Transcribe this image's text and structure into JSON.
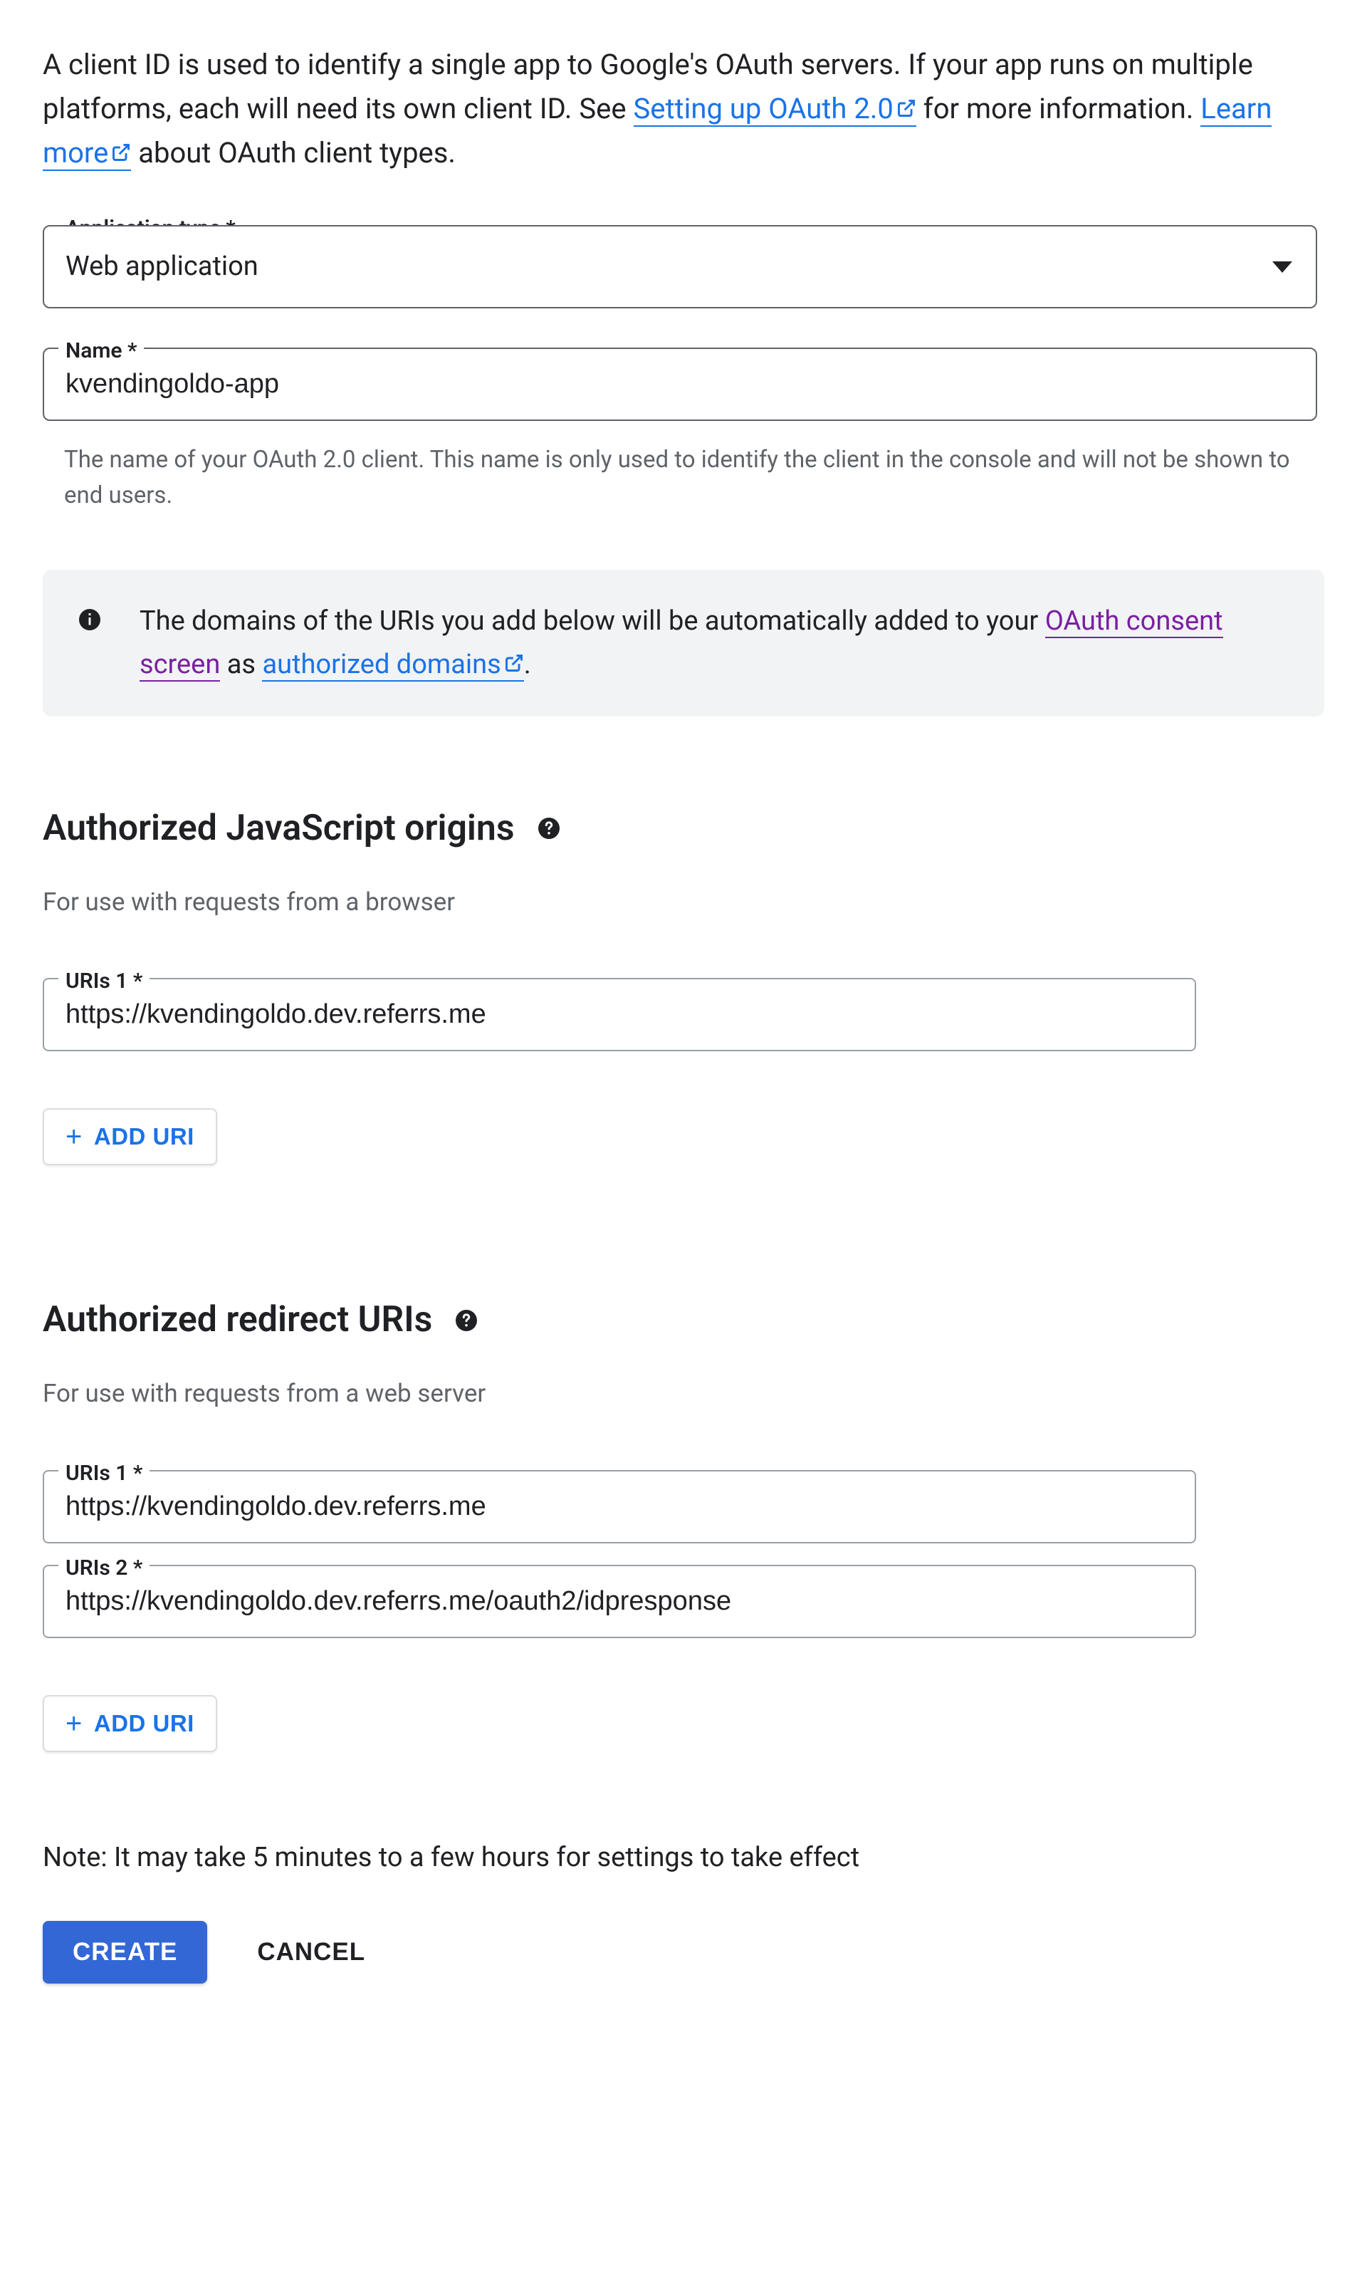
{
  "intro": {
    "text1": "A client ID is used to identify a single app to Google's OAuth servers. If your app runs on multiple platforms, each will need its own client ID. See ",
    "link1": "Setting up OAuth 2.0",
    "text2": " for more information. ",
    "link2": "Learn more",
    "text3": " about OAuth client types."
  },
  "appType": {
    "label": "Application type *",
    "value": "Web application"
  },
  "name": {
    "label": "Name *",
    "value": "kvendingoldo-app",
    "helper": "The name of your OAuth 2.0 client. This name is only used to identify the client in the console and will not be shown to end users."
  },
  "banner": {
    "text1": "The domains of the URIs you add below will be automatically added to your ",
    "link1": "OAuth consent screen",
    "text2": " as ",
    "link2": "authorized domains",
    "text3": "."
  },
  "jsOrigins": {
    "title": "Authorized JavaScript origins",
    "subtitle": "For use with requests from a browser",
    "uris": [
      {
        "label": "URIs 1 *",
        "value": "https://kvendingoldo.dev.referrs.me"
      }
    ],
    "addButton": "ADD URI"
  },
  "redirectUris": {
    "title": "Authorized redirect URIs",
    "subtitle": "For use with requests from a web server",
    "uris": [
      {
        "label": "URIs 1 *",
        "value": "https://kvendingoldo.dev.referrs.me"
      },
      {
        "label": "URIs 2 *",
        "value": "https://kvendingoldo.dev.referrs.me/oauth2/idpresponse"
      }
    ],
    "addButton": "ADD URI"
  },
  "note": "Note: It may take 5 minutes to a few hours for settings to take effect",
  "buttons": {
    "create": "CREATE",
    "cancel": "CANCEL"
  }
}
